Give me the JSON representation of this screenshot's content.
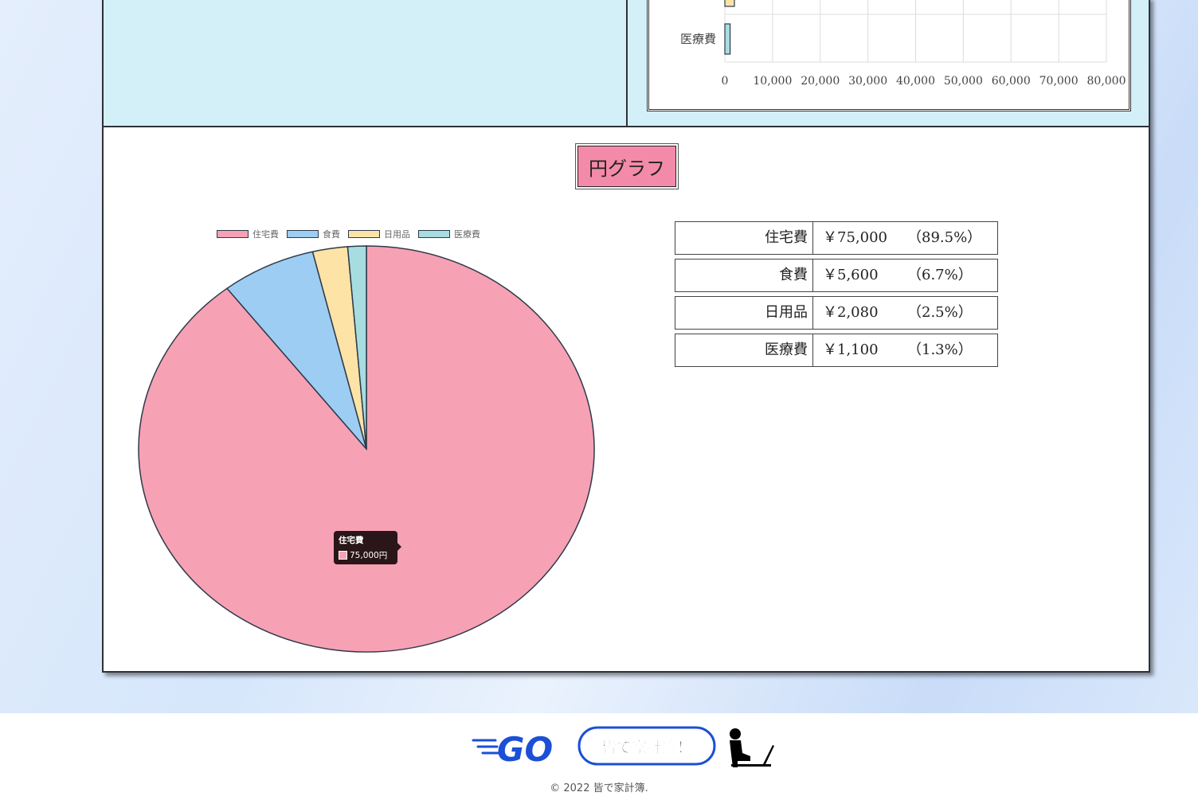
{
  "bar_chart": {
    "visible_category": "医療費",
    "x_ticks": [
      "0",
      "10,000",
      "20,000",
      "30,000",
      "40,000",
      "50,000",
      "60,000",
      "70,000",
      "80,000"
    ]
  },
  "pie_section": {
    "title": "円グラフ",
    "legend": [
      {
        "label": "住宅費",
        "color": "#f7a1b5"
      },
      {
        "label": "食費",
        "color": "#9dcdf2"
      },
      {
        "label": "日用品",
        "color": "#fde3a6"
      },
      {
        "label": "医療費",
        "color": "#a7dde0"
      }
    ],
    "tooltip": {
      "title": "住宅費",
      "value": "75,000円"
    }
  },
  "summary": [
    {
      "category": "住宅費",
      "amount": "￥75,000",
      "percent": "（89.5%）"
    },
    {
      "category": "食費",
      "amount": "￥5,600",
      "percent": "（6.7%）"
    },
    {
      "category": "日用品",
      "amount": "￥2,080",
      "percent": "（2.5%）"
    },
    {
      "category": "医療費",
      "amount": "￥1,100",
      "percent": "（1.3%）"
    }
  ],
  "chart_data": [
    {
      "type": "pie",
      "title": "円グラフ",
      "categories": [
        "住宅費",
        "食費",
        "日用品",
        "医療費"
      ],
      "values": [
        75000,
        5600,
        2080,
        1100
      ],
      "colors": [
        "#f7a1b5",
        "#9dcdf2",
        "#fde3a6",
        "#a7dde0"
      ],
      "legend_position": "top"
    },
    {
      "type": "bar",
      "orientation": "horizontal",
      "categories": [
        "医療費"
      ],
      "values": [
        1100
      ],
      "xlim": [
        0,
        80000
      ],
      "x_ticks": [
        0,
        10000,
        20000,
        30000,
        40000,
        50000,
        60000,
        70000,
        80000
      ],
      "grid": true
    }
  ],
  "footer": {
    "logo_go": "GO",
    "logo_text": "皆で家計簿！",
    "copyright": "© 2022 皆で家計簿."
  }
}
